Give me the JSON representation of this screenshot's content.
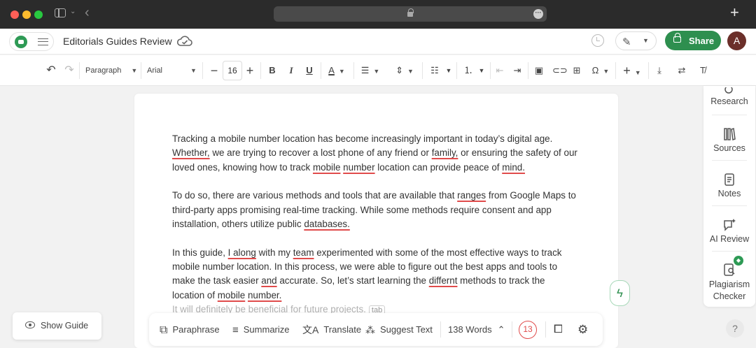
{
  "window": {
    "colors": {
      "close": "#ff5f57",
      "minimize": "#febc2e",
      "zoom": "#28c840"
    }
  },
  "header": {
    "doc_title": "Editorials Guides Review",
    "share_label": "Share",
    "avatar_initial": "A",
    "brand_color": "#2e8f4f"
  },
  "toolbar": {
    "paragraph_style": "Paragraph",
    "font": "Arial",
    "font_size": "16",
    "bold": "B",
    "italic": "I",
    "underline": "U"
  },
  "document": {
    "p1_a": "Tracking a mobile number location has become increasingly important in today’s digital age.",
    "p1_whether": "Whether,",
    "p1_b": " we are trying to recover a lost phone of any friend or ",
    "p1_family": "family,",
    "p1_c": " or ensuring the safety of our loved ones, knowing how to track ",
    "p1_mobile": "mobile",
    "p1_number": "number",
    "p1_d": " location can provide peace of ",
    "p1_mind": "mind.",
    "p2_a": "To do so, there are various methods and tools that are available that ",
    "p2_ranges": "ranges",
    "p2_b": " from Google Maps to third-party apps promising real-time tracking. While some methods require consent and app installation, others utilize public ",
    "p2_databases": "databases.",
    "p3_a": "In this guide, ",
    "p3_ialong": "I along",
    "p3_b": " with my ",
    "p3_team": "team",
    "p3_c": " experimented with some of the most effective ways to track mobile number location. In this process, we were able to figure out the best apps and tools to make the task easier ",
    "p3_and": "and",
    "p3_d": " accurate. So, let’s start learning the ",
    "p3_differnt": "differnt",
    "p3_e": " methods to track the location of ",
    "p3_mobile": "mobile",
    "p3_number": "number.",
    "suggestion": "It will definitely be beneficial for future projects.",
    "tab_hint": "tab"
  },
  "right_panel": {
    "research": "Research",
    "sources": "Sources",
    "notes": "Notes",
    "ai_review": "AI Review",
    "plagiarism_1": "Plagiarism",
    "plagiarism_2": "Checker"
  },
  "bottom_bar": {
    "paraphrase": "Paraphrase",
    "summarize": "Summarize",
    "translate": "Translate",
    "suggest_text": "Suggest Text",
    "word_count": "138 Words",
    "error_count": "13"
  },
  "show_guide": "Show Guide",
  "help": "?"
}
